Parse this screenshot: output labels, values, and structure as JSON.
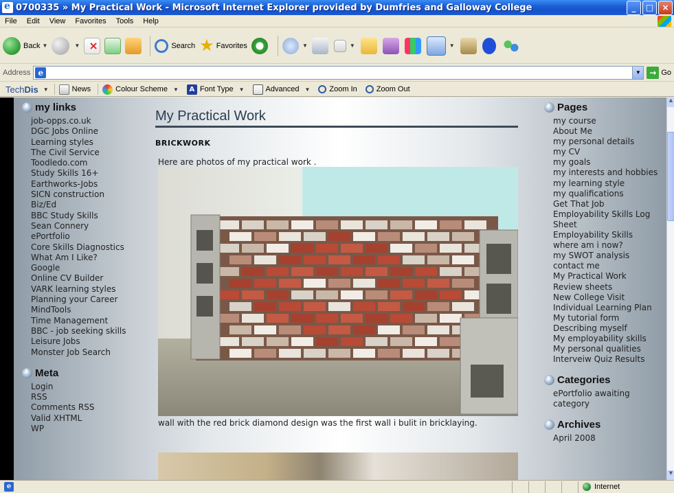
{
  "window": {
    "title": "0700335 » My Practical Work - Microsoft Internet Explorer provided by Dumfries and Galloway College",
    "minimize": "_",
    "maximize": "□",
    "close": "×"
  },
  "menu": [
    "File",
    "Edit",
    "View",
    "Favorites",
    "Tools",
    "Help"
  ],
  "toolbar": {
    "back": "Back",
    "search": "Search",
    "favorites": "Favorites"
  },
  "address": {
    "label": "Address",
    "value": "",
    "go": "Go"
  },
  "techdis": {
    "brand_a": "Tech",
    "brand_b": "Dis",
    "news": "News",
    "colour_scheme": "Colour Scheme",
    "font_type": "Font Type",
    "advanced": "Advanced",
    "zoom_in": "Zoom In",
    "zoom_out": "Zoom Out"
  },
  "left_sidebar": {
    "links_heading": "my links",
    "links": [
      "job-opps.co.uk",
      "DGC Jobs Online",
      "Learning styles",
      "The Civil Service",
      "Toodledo.com",
      "Study Skills 16+",
      "Earthworks-Jobs",
      "SICN construction",
      "Biz/Ed",
      "BBC Study Skills",
      "Sean Connery",
      "ePortfolio",
      "Core Skills Diagnostics",
      "What Am I Like?",
      "Google",
      "Online CV Builder",
      "VARK learning styles",
      "Planning your Career",
      "MindTools",
      "Time Management",
      "BBC - job seeking skills",
      "Leisure Jobs",
      "Monster Job Search"
    ],
    "meta_heading": "Meta",
    "meta": [
      "Login",
      "RSS",
      "Comments RSS",
      "Valid XHTML",
      "WP"
    ]
  },
  "main": {
    "page_title": "My Practical Work",
    "post_title": "BRICKWORK",
    "intro": "Here are photos of my practical work .",
    "caption": "wall with the red brick diamond design was the first wall i bulit in bricklaying."
  },
  "right_sidebar": {
    "pages_heading": "Pages",
    "pages": [
      "my course",
      "About Me",
      "my personal details",
      "my CV",
      "my goals",
      "my interests and hobbies",
      "my learning style",
      "my qualifications",
      "Get That Job",
      "Employability Skills Log Sheet",
      "Employability Skills",
      "where am i now?",
      "my SWOT analysis",
      "contact me",
      "My Practical Work",
      "Review sheets",
      "New College Visit",
      "Individual Learning Plan",
      "My tutorial form",
      "Describing myself",
      "My employability skills",
      "My personal qualities",
      "Interveiw Quiz Results"
    ],
    "categories_heading": "Categories",
    "categories": [
      "ePortfolio awaiting category"
    ],
    "archives_heading": "Archives",
    "archives": [
      "April 2008"
    ]
  },
  "status": {
    "zone": "Internet"
  }
}
